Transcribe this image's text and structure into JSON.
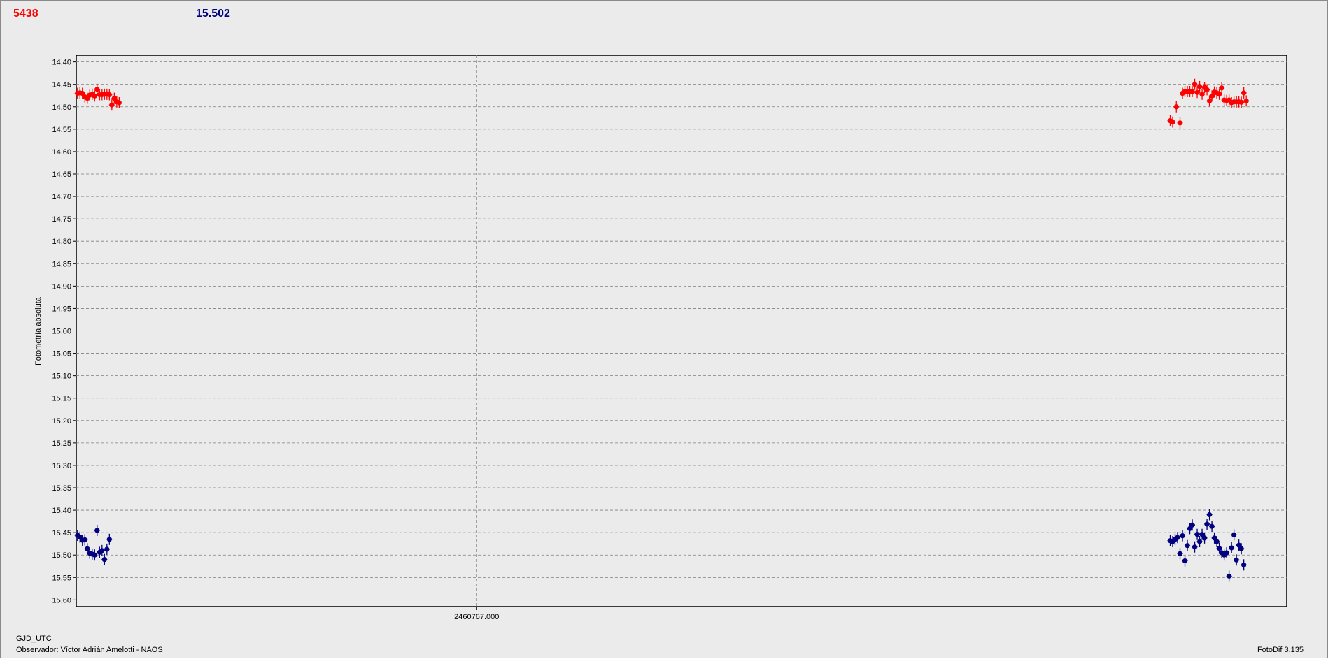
{
  "header": {
    "series1_label": "5438",
    "series2_label": "15.502"
  },
  "footer": {
    "x_unit": "GJD_UTC",
    "observer": "Observador: Víctor Adrián Amelotti - NAOS",
    "software": "FotoDif 3.135"
  },
  "colors": {
    "series1": "#ff0000",
    "series2": "#000080",
    "background": "#ebebeb",
    "grid": "#808080"
  },
  "chart_data": {
    "type": "scatter",
    "ylabel": "Fotometría absoluta",
    "xlabel": "GJD_UTC",
    "y_inverted": true,
    "ylim": [
      14.385,
      15.615
    ],
    "yticks": [
      "14.40",
      "14.45",
      "14.50",
      "14.55",
      "14.60",
      "14.65",
      "14.70",
      "14.75",
      "14.80",
      "14.85",
      "14.90",
      "14.95",
      "15.00",
      "15.05",
      "15.10",
      "15.15",
      "15.20",
      "15.25",
      "15.30",
      "15.35",
      "15.40",
      "15.45",
      "15.50",
      "15.55",
      "15.60"
    ],
    "x_ticks": [
      {
        "value": 0,
        "label": "2460767.000"
      }
    ],
    "x_range_relative": [
      -0.3265,
      0.6605
    ],
    "x_note": "x values are days relative to 2460767.000",
    "grid": true,
    "series": [
      {
        "name": "5438",
        "color": "#ff0000",
        "points": [
          [
            -0.3255,
            14.47
          ],
          [
            -0.3235,
            14.469
          ],
          [
            -0.3215,
            14.47
          ],
          [
            -0.3195,
            14.478
          ],
          [
            -0.3175,
            14.481
          ],
          [
            -0.3155,
            14.474
          ],
          [
            -0.3135,
            14.472
          ],
          [
            -0.3115,
            14.476
          ],
          [
            -0.3095,
            14.461
          ],
          [
            -0.3075,
            14.473
          ],
          [
            -0.3055,
            14.473
          ],
          [
            -0.3035,
            14.472
          ],
          [
            -0.3015,
            14.472
          ],
          [
            -0.2995,
            14.473
          ],
          [
            -0.2975,
            14.496
          ],
          [
            -0.2955,
            14.481
          ],
          [
            -0.2935,
            14.489
          ],
          [
            -0.2915,
            14.491
          ],
          [
            0.5655,
            14.531
          ],
          [
            0.5675,
            14.534
          ],
          [
            0.5705,
            14.5
          ],
          [
            0.5735,
            14.536
          ],
          [
            0.5755,
            14.47
          ],
          [
            0.5775,
            14.466
          ],
          [
            0.5795,
            14.466
          ],
          [
            0.5815,
            14.466
          ],
          [
            0.5835,
            14.466
          ],
          [
            0.5855,
            14.45
          ],
          [
            0.5875,
            14.468
          ],
          [
            0.5895,
            14.455
          ],
          [
            0.5915,
            14.472
          ],
          [
            0.5935,
            14.457
          ],
          [
            0.5955,
            14.462
          ],
          [
            0.5975,
            14.487
          ],
          [
            0.5995,
            14.476
          ],
          [
            0.6015,
            14.467
          ],
          [
            0.6035,
            14.469
          ],
          [
            0.6055,
            14.472
          ],
          [
            0.6075,
            14.458
          ],
          [
            0.6095,
            14.485
          ],
          [
            0.6115,
            14.486
          ],
          [
            0.6135,
            14.485
          ],
          [
            0.6155,
            14.491
          ],
          [
            0.6175,
            14.489
          ],
          [
            0.6195,
            14.489
          ],
          [
            0.6215,
            14.489
          ],
          [
            0.6235,
            14.49
          ],
          [
            0.6255,
            14.469
          ],
          [
            0.6275,
            14.487
          ]
        ]
      },
      {
        "name": "15.502",
        "color": "#000080",
        "points": [
          [
            -0.3255,
            15.456
          ],
          [
            -0.3235,
            15.46
          ],
          [
            -0.3215,
            15.467
          ],
          [
            -0.3195,
            15.466
          ],
          [
            -0.3175,
            15.486
          ],
          [
            -0.3155,
            15.496
          ],
          [
            -0.3135,
            15.498
          ],
          [
            -0.3115,
            15.5
          ],
          [
            -0.3095,
            15.445
          ],
          [
            -0.3075,
            15.494
          ],
          [
            -0.3055,
            15.49
          ],
          [
            -0.3035,
            15.51
          ],
          [
            -0.3015,
            15.487
          ],
          [
            -0.2995,
            15.465
          ],
          [
            0.5655,
            15.468
          ],
          [
            0.5675,
            15.47
          ],
          [
            0.5695,
            15.465
          ],
          [
            0.5715,
            15.461
          ],
          [
            0.5735,
            15.497
          ],
          [
            0.5755,
            15.457
          ],
          [
            0.5775,
            15.513
          ],
          [
            0.5795,
            15.479
          ],
          [
            0.5815,
            15.441
          ],
          [
            0.5835,
            15.433
          ],
          [
            0.5855,
            15.482
          ],
          [
            0.5875,
            15.454
          ],
          [
            0.5895,
            15.47
          ],
          [
            0.5915,
            15.454
          ],
          [
            0.5935,
            15.462
          ],
          [
            0.5955,
            15.431
          ],
          [
            0.5975,
            15.41
          ],
          [
            0.5995,
            15.436
          ],
          [
            0.6015,
            15.462
          ],
          [
            0.6035,
            15.47
          ],
          [
            0.6055,
            15.485
          ],
          [
            0.6075,
            15.495
          ],
          [
            0.6095,
            15.5
          ],
          [
            0.6115,
            15.495
          ],
          [
            0.6135,
            15.547
          ],
          [
            0.6155,
            15.484
          ],
          [
            0.6175,
            15.455
          ],
          [
            0.6195,
            15.511
          ],
          [
            0.6215,
            15.478
          ],
          [
            0.6235,
            15.486
          ],
          [
            0.6255,
            15.522
          ]
        ]
      }
    ]
  }
}
